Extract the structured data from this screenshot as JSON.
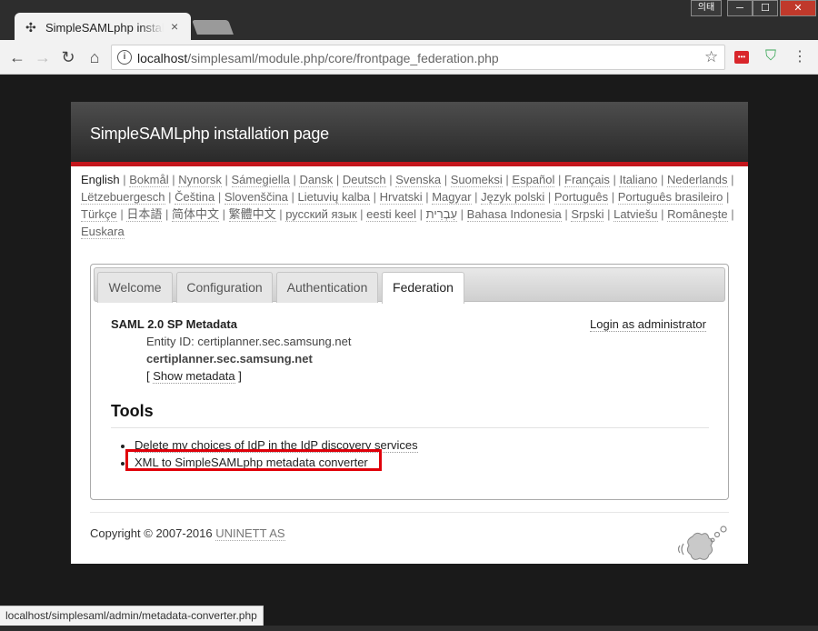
{
  "window": {
    "ime_label": "의태",
    "min": "─",
    "max": "☐",
    "close": "✕"
  },
  "tabs": {
    "active_title": "SimpleSAMLphp installation page",
    "close": "×",
    "favicon": "puzzle-icon"
  },
  "toolbar": {
    "back": "←",
    "forward": "→",
    "reload": "↻",
    "home": "⌂",
    "info_glyph": "i",
    "url_host": "localhost",
    "url_path": "/simplesaml/module.php/core/frontpage_federation.php",
    "star": "☆",
    "ext1_label": "•••",
    "ext2_glyph": "⛉",
    "menu": "⋮"
  },
  "page": {
    "header_title": "SimpleSAMLphp installation page",
    "languages": [
      "English",
      "Bokmål",
      "Nynorsk",
      "Sámegiella",
      "Dansk",
      "Deutsch",
      "Svenska",
      "Suomeksi",
      "Español",
      "Français",
      "Italiano",
      "Nederlands",
      "Lëtzebuergesch",
      "Čeština",
      "Slovenščina",
      "Lietuvių kalba",
      "Hrvatski",
      "Magyar",
      "Język polski",
      "Português",
      "Português brasileiro",
      "Türkçe",
      "日本語",
      "简体中文",
      "繁體中文",
      "русский язык",
      "eesti keel",
      "עִבְרִית",
      "Bahasa Indonesia",
      "Srpski",
      "Latviešu",
      "Românește",
      "Euskara"
    ],
    "tabs": [
      "Welcome",
      "Configuration",
      "Authentication",
      "Federation"
    ],
    "sp_title": "SAML 2.0 SP Metadata",
    "login_link": "Login as administrator",
    "entity_id": "Entity ID: certiplanner.sec.samsung.net",
    "entity_name": "certiplanner.sec.samsung.net",
    "show_metadata_open": "[ ",
    "show_metadata": "Show metadata",
    "show_metadata_close": " ]",
    "tools_heading": "Tools",
    "tools": [
      "Delete my choices of IdP in the IdP discovery services",
      "XML to SimpleSAMLphp metadata converter"
    ],
    "copyright_prefix": "Copyright © 2007-2016 ",
    "copyright_org": "UNINETT AS"
  },
  "status_url": "localhost/simplesaml/admin/metadata-converter.php",
  "colors": {
    "header_stripe": "#c4161c",
    "highlight": "#e0000a"
  }
}
